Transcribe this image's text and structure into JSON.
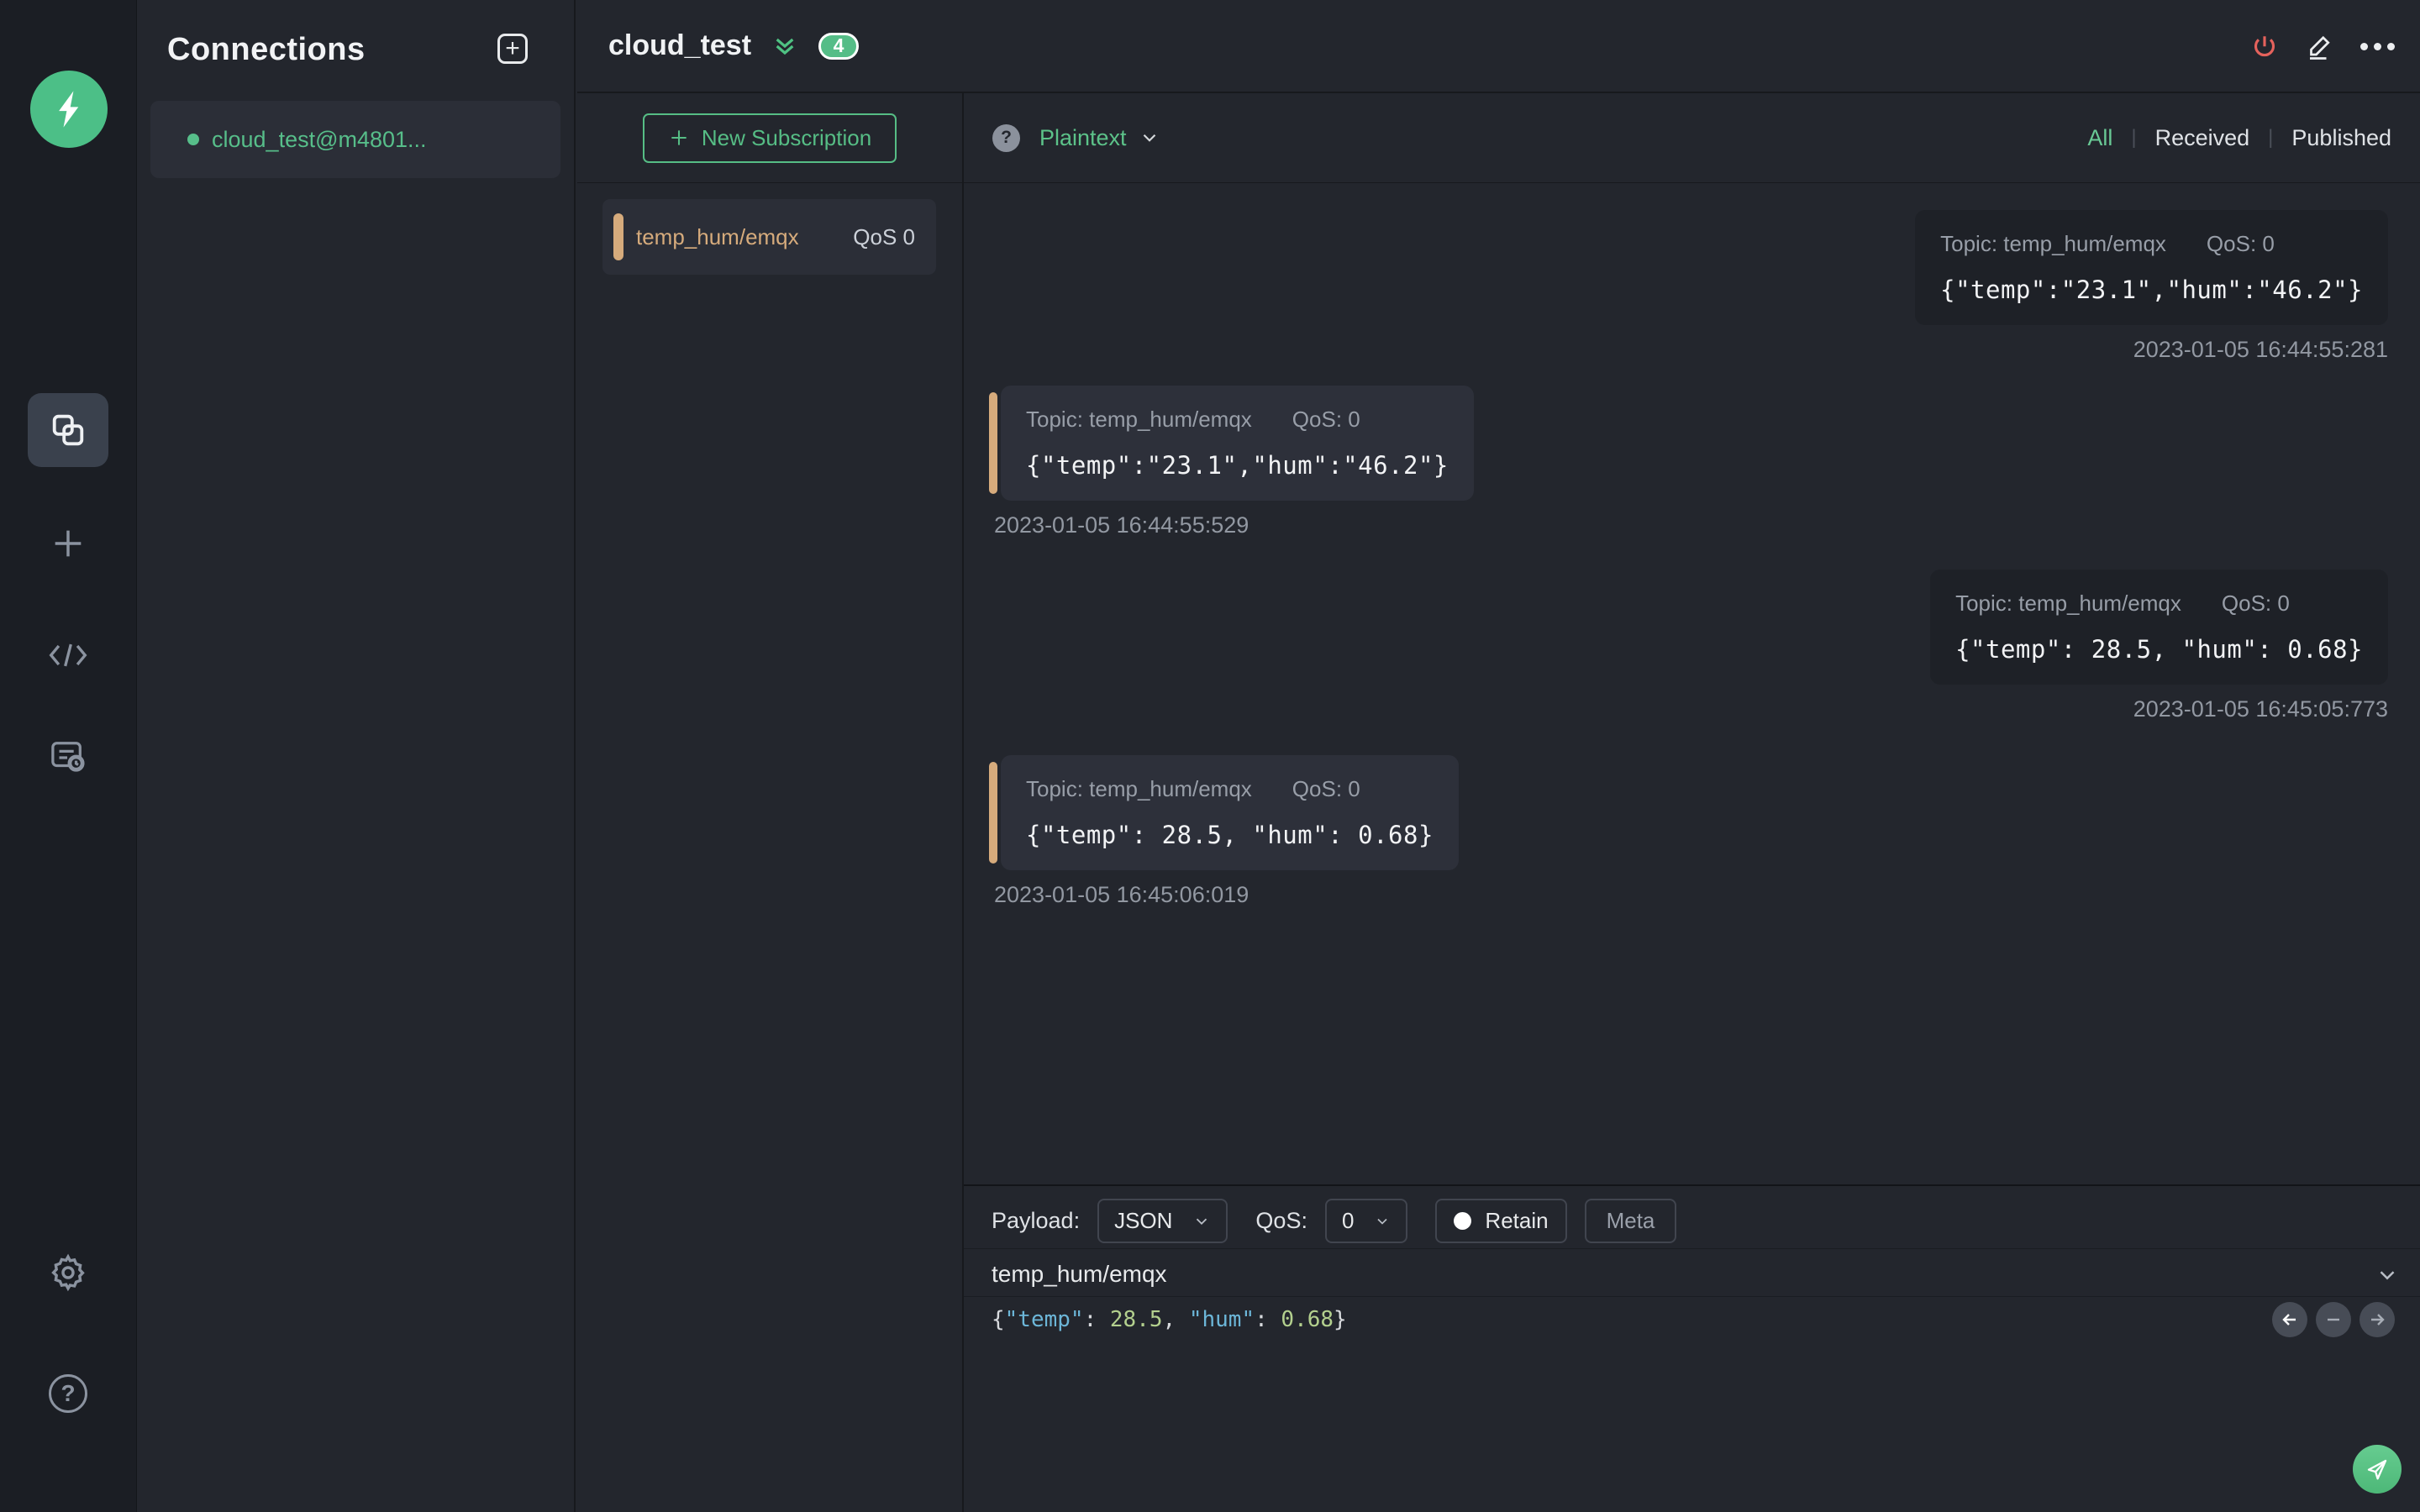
{
  "colors": {
    "accent_green": "#56bd85",
    "tan_accent": "#d6ab7c",
    "power_red": "#e5625c",
    "panel_bg": "#23262d",
    "rail_bg": "#1b1e24",
    "bubble_published_bg": "#1e2127",
    "bubble_received_bg": "#2d303a",
    "json_key_color": "#6cb6d8",
    "json_num_color": "#b3d08e"
  },
  "connections_panel": {
    "title": "Connections",
    "add_button": "+",
    "items": [
      {
        "name": "cloud_test@m4801...",
        "status": "connected"
      }
    ]
  },
  "header": {
    "title": "cloud_test",
    "badge_count": "4"
  },
  "subscriptions": {
    "new_button_label": "New Subscription",
    "items": [
      {
        "topic": "temp_hum/emqx",
        "qos": "QoS 0"
      }
    ]
  },
  "messages": {
    "format_label": "Plaintext",
    "help_glyph": "?",
    "filters": [
      {
        "label": "All"
      },
      {
        "label": "Received"
      },
      {
        "label": "Published"
      }
    ],
    "items": [
      {
        "direction": "published",
        "topic_label": "Topic: temp_hum/emqx",
        "qos_label": "QoS: 0",
        "payload": "{\"temp\":\"23.1\",\"hum\":\"46.2\"}",
        "timestamp": "2023-01-05 16:44:55:281"
      },
      {
        "direction": "received",
        "topic_label": "Topic: temp_hum/emqx",
        "qos_label": "QoS: 0",
        "payload": "{\"temp\":\"23.1\",\"hum\":\"46.2\"}",
        "timestamp": "2023-01-05 16:44:55:529"
      },
      {
        "direction": "published",
        "topic_label": "Topic: temp_hum/emqx",
        "qos_label": "QoS: 0",
        "payload": "{\"temp\": 28.5, \"hum\": 0.68}",
        "timestamp": "2023-01-05 16:45:05:773"
      },
      {
        "direction": "received",
        "topic_label": "Topic: temp_hum/emqx",
        "qos_label": "QoS: 0",
        "payload": "{\"temp\": 28.5, \"hum\": 0.68}",
        "timestamp": "2023-01-05 16:45:06:019"
      }
    ]
  },
  "composer": {
    "payload_label": "Payload:",
    "payload_format": "JSON",
    "qos_label": "QoS:",
    "qos_value": "0",
    "retain_label": "Retain",
    "meta_label": "Meta",
    "topic": "temp_hum/emqx",
    "payload_tokens": {
      "open": "{",
      "key1": "\"temp\"",
      "colon1": ": ",
      "val1": "28.5",
      "comma": ", ",
      "key2": "\"hum\"",
      "colon2": ": ",
      "val2": "0.68",
      "close": "}"
    }
  }
}
